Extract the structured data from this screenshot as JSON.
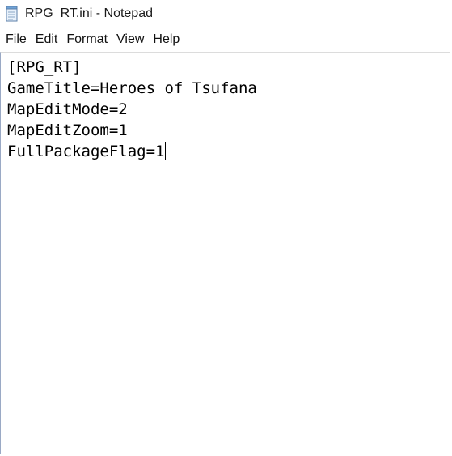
{
  "window": {
    "title": "RPG_RT.ini - Notepad",
    "icon": "notepad-icon"
  },
  "menu": {
    "items": [
      "File",
      "Edit",
      "Format",
      "View",
      "Help"
    ]
  },
  "editor": {
    "lines": [
      "[RPG_RT]",
      "GameTitle=Heroes of Tsufana",
      "MapEditMode=2",
      "MapEditZoom=1",
      "FullPackageFlag=1"
    ]
  }
}
